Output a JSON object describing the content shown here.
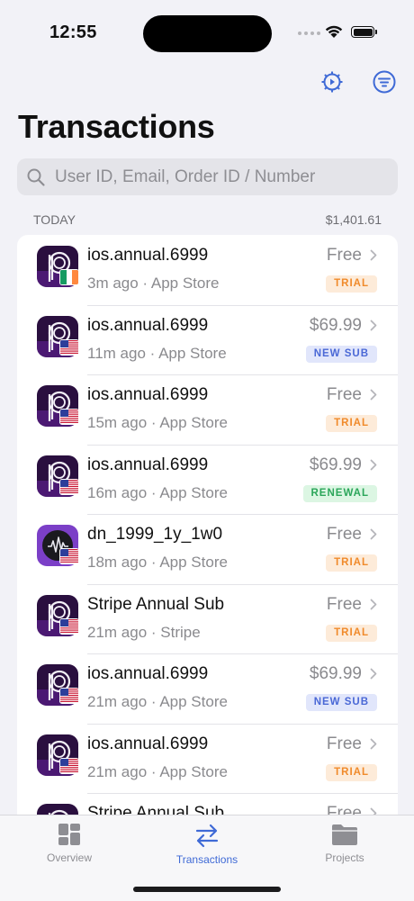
{
  "status_bar": {
    "time": "12:55"
  },
  "header": {
    "title": "Transactions",
    "settings_icon": "gear-icon",
    "filter_icon": "filter-icon"
  },
  "search": {
    "placeholder": "User ID, Email, Order ID / Number",
    "value": ""
  },
  "section": {
    "label": "TODAY",
    "total": "$1,401.61"
  },
  "transactions": [
    {
      "product": "ios.annual.6999",
      "meta": "3m ago · App Store",
      "price": "Free",
      "badge": "TRIAL",
      "badge_type": "trial",
      "flag": "ie",
      "app": "dark"
    },
    {
      "product": "ios.annual.6999",
      "meta": "11m ago · App Store",
      "price": "$69.99",
      "badge": "NEW SUB",
      "badge_type": "new",
      "flag": "us",
      "app": "dark"
    },
    {
      "product": "ios.annual.6999",
      "meta": "15m ago · App Store",
      "price": "Free",
      "badge": "TRIAL",
      "badge_type": "trial",
      "flag": "us",
      "app": "dark"
    },
    {
      "product": "ios.annual.6999",
      "meta": "16m ago · App Store",
      "price": "$69.99",
      "badge": "RENEWAL",
      "badge_type": "renewal",
      "flag": "us",
      "app": "dark"
    },
    {
      "product": "dn_1999_1y_1w0",
      "meta": "18m ago · App Store",
      "price": "Free",
      "badge": "TRIAL",
      "badge_type": "trial",
      "flag": "us",
      "app": "purple"
    },
    {
      "product": "Stripe Annual Sub",
      "meta": "21m ago · Stripe",
      "price": "Free",
      "badge": "TRIAL",
      "badge_type": "trial",
      "flag": "us",
      "app": "dark"
    },
    {
      "product": "ios.annual.6999",
      "meta": "21m ago · App Store",
      "price": "$69.99",
      "badge": "NEW SUB",
      "badge_type": "new",
      "flag": "us",
      "app": "dark"
    },
    {
      "product": "ios.annual.6999",
      "meta": "21m ago · App Store",
      "price": "Free",
      "badge": "TRIAL",
      "badge_type": "trial",
      "flag": "us",
      "app": "dark"
    },
    {
      "product": "Stripe Annual Sub",
      "meta": "",
      "price": "Free",
      "badge": "",
      "badge_type": "trial",
      "flag": "us",
      "app": "dark"
    }
  ],
  "badge_colors": {
    "trial": {
      "bg": "#fdebd9",
      "fg": "#f08a2a"
    },
    "new": {
      "bg": "#e1e6fb",
      "fg": "#4a68d6"
    },
    "renewal": {
      "bg": "#dcf6e3",
      "fg": "#2ba65a"
    }
  },
  "tabs": [
    {
      "label": "Overview",
      "icon": "grid-icon",
      "active": false
    },
    {
      "label": "Transactions",
      "icon": "arrows-swap-icon",
      "active": true
    },
    {
      "label": "Projects",
      "icon": "folder-icon",
      "active": false
    }
  ],
  "accent_color": "#3f6ad6"
}
